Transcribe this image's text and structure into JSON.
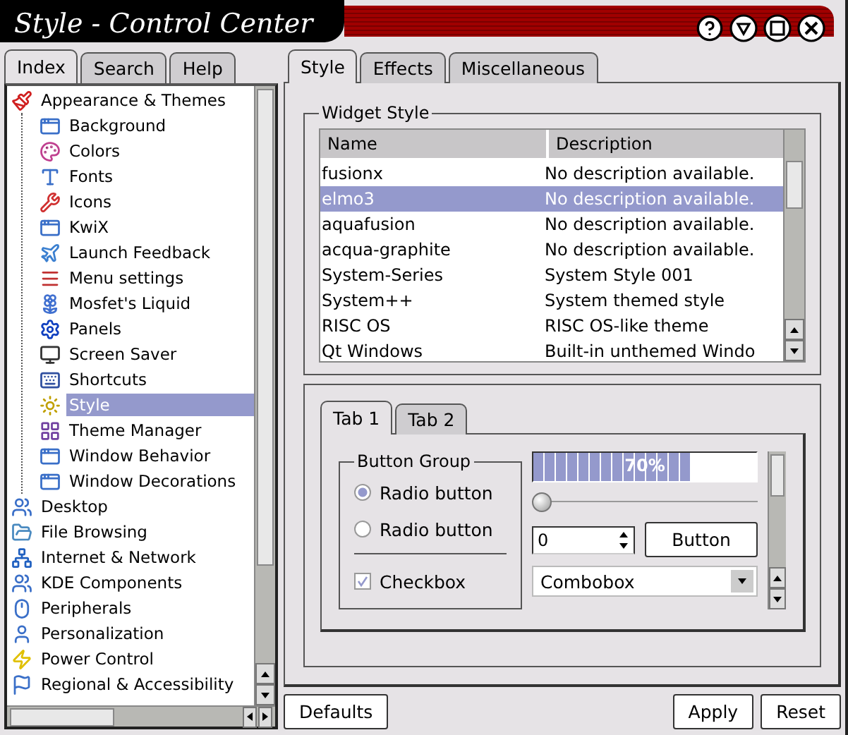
{
  "window": {
    "title": "Style - Control Center"
  },
  "sidebar": {
    "tabs": [
      {
        "label": "Index",
        "selected": true
      },
      {
        "label": "Search",
        "selected": false
      },
      {
        "label": "Help",
        "selected": false
      }
    ],
    "tree": [
      {
        "label": "Appearance & Themes",
        "selected": false,
        "expanded": true,
        "children": [
          {
            "label": "Background",
            "selected": false
          },
          {
            "label": "Colors",
            "selected": false
          },
          {
            "label": "Fonts",
            "selected": false
          },
          {
            "label": "Icons",
            "selected": false
          },
          {
            "label": "KwiX",
            "selected": false
          },
          {
            "label": "Launch Feedback",
            "selected": false
          },
          {
            "label": "Menu settings",
            "selected": false
          },
          {
            "label": "Mosfet's Liquid",
            "selected": false
          },
          {
            "label": "Panels",
            "selected": false
          },
          {
            "label": "Screen Saver",
            "selected": false
          },
          {
            "label": "Shortcuts",
            "selected": false
          },
          {
            "label": "Style",
            "selected": true
          },
          {
            "label": "Theme Manager",
            "selected": false
          },
          {
            "label": "Window Behavior",
            "selected": false
          },
          {
            "label": "Window Decorations",
            "selected": false
          }
        ]
      },
      {
        "label": "Desktop",
        "selected": false
      },
      {
        "label": "File Browsing",
        "selected": false
      },
      {
        "label": "Internet & Network",
        "selected": false
      },
      {
        "label": "KDE Components",
        "selected": false
      },
      {
        "label": "Peripherals",
        "selected": false
      },
      {
        "label": "Personalization",
        "selected": false
      },
      {
        "label": "Power Control",
        "selected": false
      },
      {
        "label": "Regional & Accessibility",
        "selected": false
      }
    ]
  },
  "module": {
    "tabs": [
      {
        "label": "Style",
        "selected": true
      },
      {
        "label": "Effects",
        "selected": false
      },
      {
        "label": "Miscellaneous",
        "selected": false
      }
    ],
    "widget_style": {
      "title": "Widget Style",
      "columns": [
        "Name",
        "Description"
      ],
      "rows": [
        {
          "cells": [
            "fusionx",
            "No description available."
          ],
          "selected": false
        },
        {
          "cells": [
            "elmo3",
            "No description available."
          ],
          "selected": true
        },
        {
          "cells": [
            "aquafusion",
            "No description available."
          ],
          "selected": false
        },
        {
          "cells": [
            "acqua-graphite",
            "No description available."
          ],
          "selected": false
        },
        {
          "cells": [
            "System-Series",
            "System Style 001"
          ],
          "selected": false
        },
        {
          "cells": [
            "System++",
            "System themed style"
          ],
          "selected": false
        },
        {
          "cells": [
            "RISC OS",
            "RISC OS-like theme"
          ],
          "selected": false
        },
        {
          "cells": [
            "Qt Windows",
            "Built-in unthemed Windo"
          ],
          "selected": false
        }
      ]
    },
    "preview": {
      "tabs": [
        {
          "label": "Tab 1",
          "selected": true
        },
        {
          "label": "Tab 2",
          "selected": false
        }
      ],
      "group": {
        "title": "Button Group",
        "radios": [
          {
            "label": "Radio button",
            "selected": true
          },
          {
            "label": "Radio button",
            "selected": false
          }
        ],
        "checkbox": {
          "label": "Checkbox",
          "checked": true
        }
      },
      "progress": {
        "level": 0.7,
        "reading": "70%"
      },
      "slider": {
        "level": 0
      },
      "spinbox": {
        "value": "0"
      },
      "button": "Button",
      "combobox": {
        "value": "Combobox"
      }
    }
  },
  "buttons": {
    "left": [
      "Defaults"
    ],
    "right": [
      "Apply",
      "Reset"
    ]
  }
}
